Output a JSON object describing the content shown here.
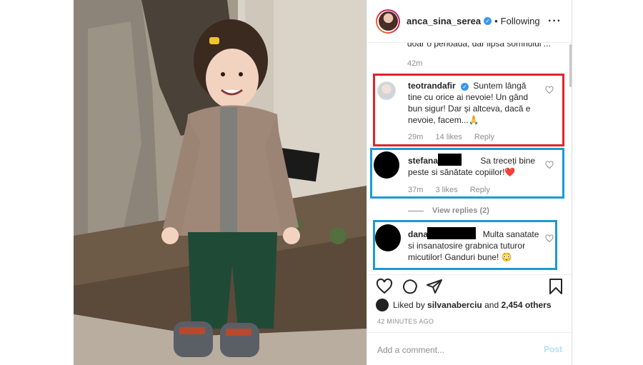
{
  "header": {
    "username": "anca_sina_serea",
    "separator": "•",
    "following_label": "Following",
    "more_icon": "more-horizontal-icon"
  },
  "previous_comment": {
    "text": "doar o perioada, dar lipsa somnului ...",
    "time": "42m"
  },
  "comments": [
    {
      "username": "teotrandafir",
      "text": "Suntem lângă tine cu orice ai nevoie! Un gând bun sigur! Dar și altceva, dacă e nevoie, facem...🙏",
      "time": "29m",
      "likes": "14 likes",
      "reply": "Reply",
      "highlight": "#e0252b"
    },
    {
      "username": "stefana_",
      "text": "Sa treceți bine peste si sănătate copiilor!❤️",
      "time": "37m",
      "likes": "3 likes",
      "reply": "Reply",
      "highlight": "#1b9ad6"
    },
    {
      "username": "dana",
      "text": "Multa sanatate si insanatosire grabnica tuturor micutilor! Ganduri bune! 😳",
      "highlight": "#1b9ad6"
    }
  ],
  "view_replies": "View replies (2)",
  "actions": {
    "icons": [
      "heart-icon",
      "comment-icon",
      "share-icon",
      "bookmark-icon"
    ]
  },
  "liked_by": {
    "prefix": "Liked by",
    "user": "silvanaberciu",
    "middle": "and",
    "others": "2,454 others"
  },
  "timestamp": "42 MINUTES AGO",
  "add_comment": {
    "placeholder": "Add a comment...",
    "post_label": "Post"
  },
  "colors": {
    "verified": "#3897f0",
    "red_highlight": "#e0252b",
    "blue_highlight": "#1b9ad6",
    "post_disabled": "#b2dffc"
  }
}
